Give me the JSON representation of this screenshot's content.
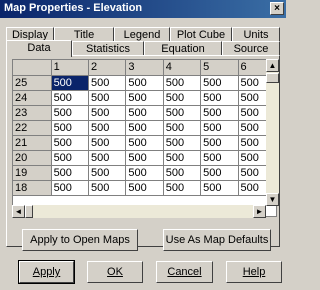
{
  "window": {
    "title": "Map Properties - Elevation",
    "close_glyph": "×"
  },
  "tabs_row1": [
    "Display",
    "Title",
    "Legend",
    "Plot Cube",
    "Units"
  ],
  "tabs_row2": [
    "Data",
    "Statistics",
    "Equation",
    "Source"
  ],
  "active_tab": "Data",
  "grid": {
    "col_headers": [
      "",
      "1",
      "2",
      "3",
      "4",
      "5",
      "6"
    ],
    "rows": [
      {
        "id": "25",
        "values": [
          "500",
          "500",
          "500",
          "500",
          "500",
          "500"
        ]
      },
      {
        "id": "24",
        "values": [
          "500",
          "500",
          "500",
          "500",
          "500",
          "500"
        ]
      },
      {
        "id": "23",
        "values": [
          "500",
          "500",
          "500",
          "500",
          "500",
          "500"
        ]
      },
      {
        "id": "22",
        "values": [
          "500",
          "500",
          "500",
          "500",
          "500",
          "500"
        ]
      },
      {
        "id": "21",
        "values": [
          "500",
          "500",
          "500",
          "500",
          "500",
          "500"
        ]
      },
      {
        "id": "20",
        "values": [
          "500",
          "500",
          "500",
          "500",
          "500",
          "500"
        ]
      },
      {
        "id": "19",
        "values": [
          "500",
          "500",
          "500",
          "500",
          "500",
          "500"
        ]
      },
      {
        "id": "18",
        "values": [
          "500",
          "500",
          "500",
          "500",
          "500",
          "500"
        ]
      }
    ],
    "selected_cell": {
      "row": "25",
      "col": "1"
    }
  },
  "buttons": {
    "apply_open_maps": "Apply to Open Maps",
    "use_defaults": "Use As Map Defaults",
    "apply": "Apply",
    "ok": "OK",
    "cancel": "Cancel",
    "help": "Help"
  },
  "icons": {
    "up": "▲",
    "down": "▼",
    "left": "◄",
    "right": "►"
  }
}
